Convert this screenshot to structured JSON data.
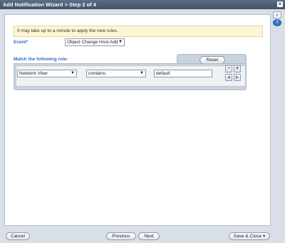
{
  "window": {
    "title": "Add Notification Wizard > Step 2 of 4"
  },
  "info": {
    "message": "It may take up to a minute to apply the new rules."
  },
  "event": {
    "label": "Event*",
    "value": "Object Change Host Add"
  },
  "match": {
    "label": "Match the following rule:",
    "reset_label": "Reset"
  },
  "rule": {
    "field": "Network View",
    "operator": "contains",
    "value": "default"
  },
  "rule_buttons": {
    "remove": "−",
    "add": "+",
    "prev": "◂|",
    "next": "|▸"
  },
  "sidebar": {
    "collapse": "«",
    "help": "?"
  },
  "footer": {
    "cancel": "Cancel",
    "previous": "Previous",
    "next": "Next",
    "save_close": "Save & Close",
    "save_arrow": "▾"
  },
  "colors": {
    "titlebar": "#3f526a",
    "label": "#2f6fbf",
    "info_bg": "#fdf5d4",
    "panel_bg": "#d9dfe6"
  },
  "icons": [
    "close-icon",
    "collapse-icon",
    "help-icon",
    "dropdown-arrow-icon"
  ]
}
